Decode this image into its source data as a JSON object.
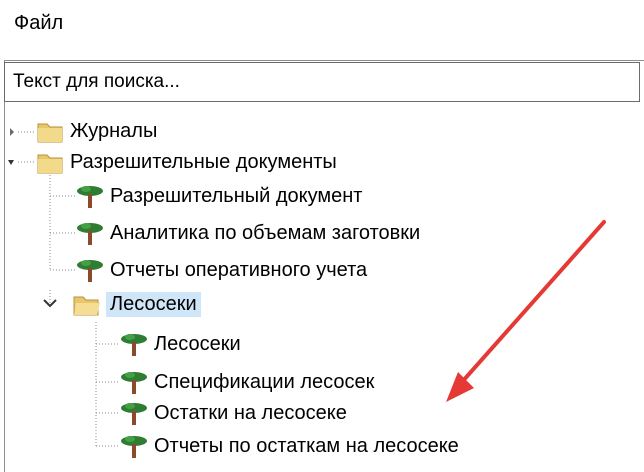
{
  "menu": {
    "file_label": "Файл"
  },
  "search": {
    "placeholder": "Текст для поиска..."
  },
  "tree": {
    "journals": "Журналы",
    "permits": "Разрешительные документы",
    "permit_doc": "Разрешительный документ",
    "harvest_analytics": "Аналитика по объемам заготовки",
    "operational_reports": "Отчеты оперативного учета",
    "cutting_areas": "Лесосеки",
    "cutting_areas_child": "Лесосеки",
    "cutting_area_specs": "Спецификации лесосек",
    "remains_on_area": "Остатки на лесосеке",
    "remains_reports": "Отчеты по остаткам на лесосеке"
  },
  "colors": {
    "folder": "#e8c66a",
    "tree_crown": "#2e7d32",
    "tree_trunk": "#8b4a2b",
    "selection": "#cfe5f8",
    "annotation_arrow": "#e53935"
  },
  "icons": [
    "folder-icon",
    "tree-icon",
    "expand-chevron-icon"
  ]
}
